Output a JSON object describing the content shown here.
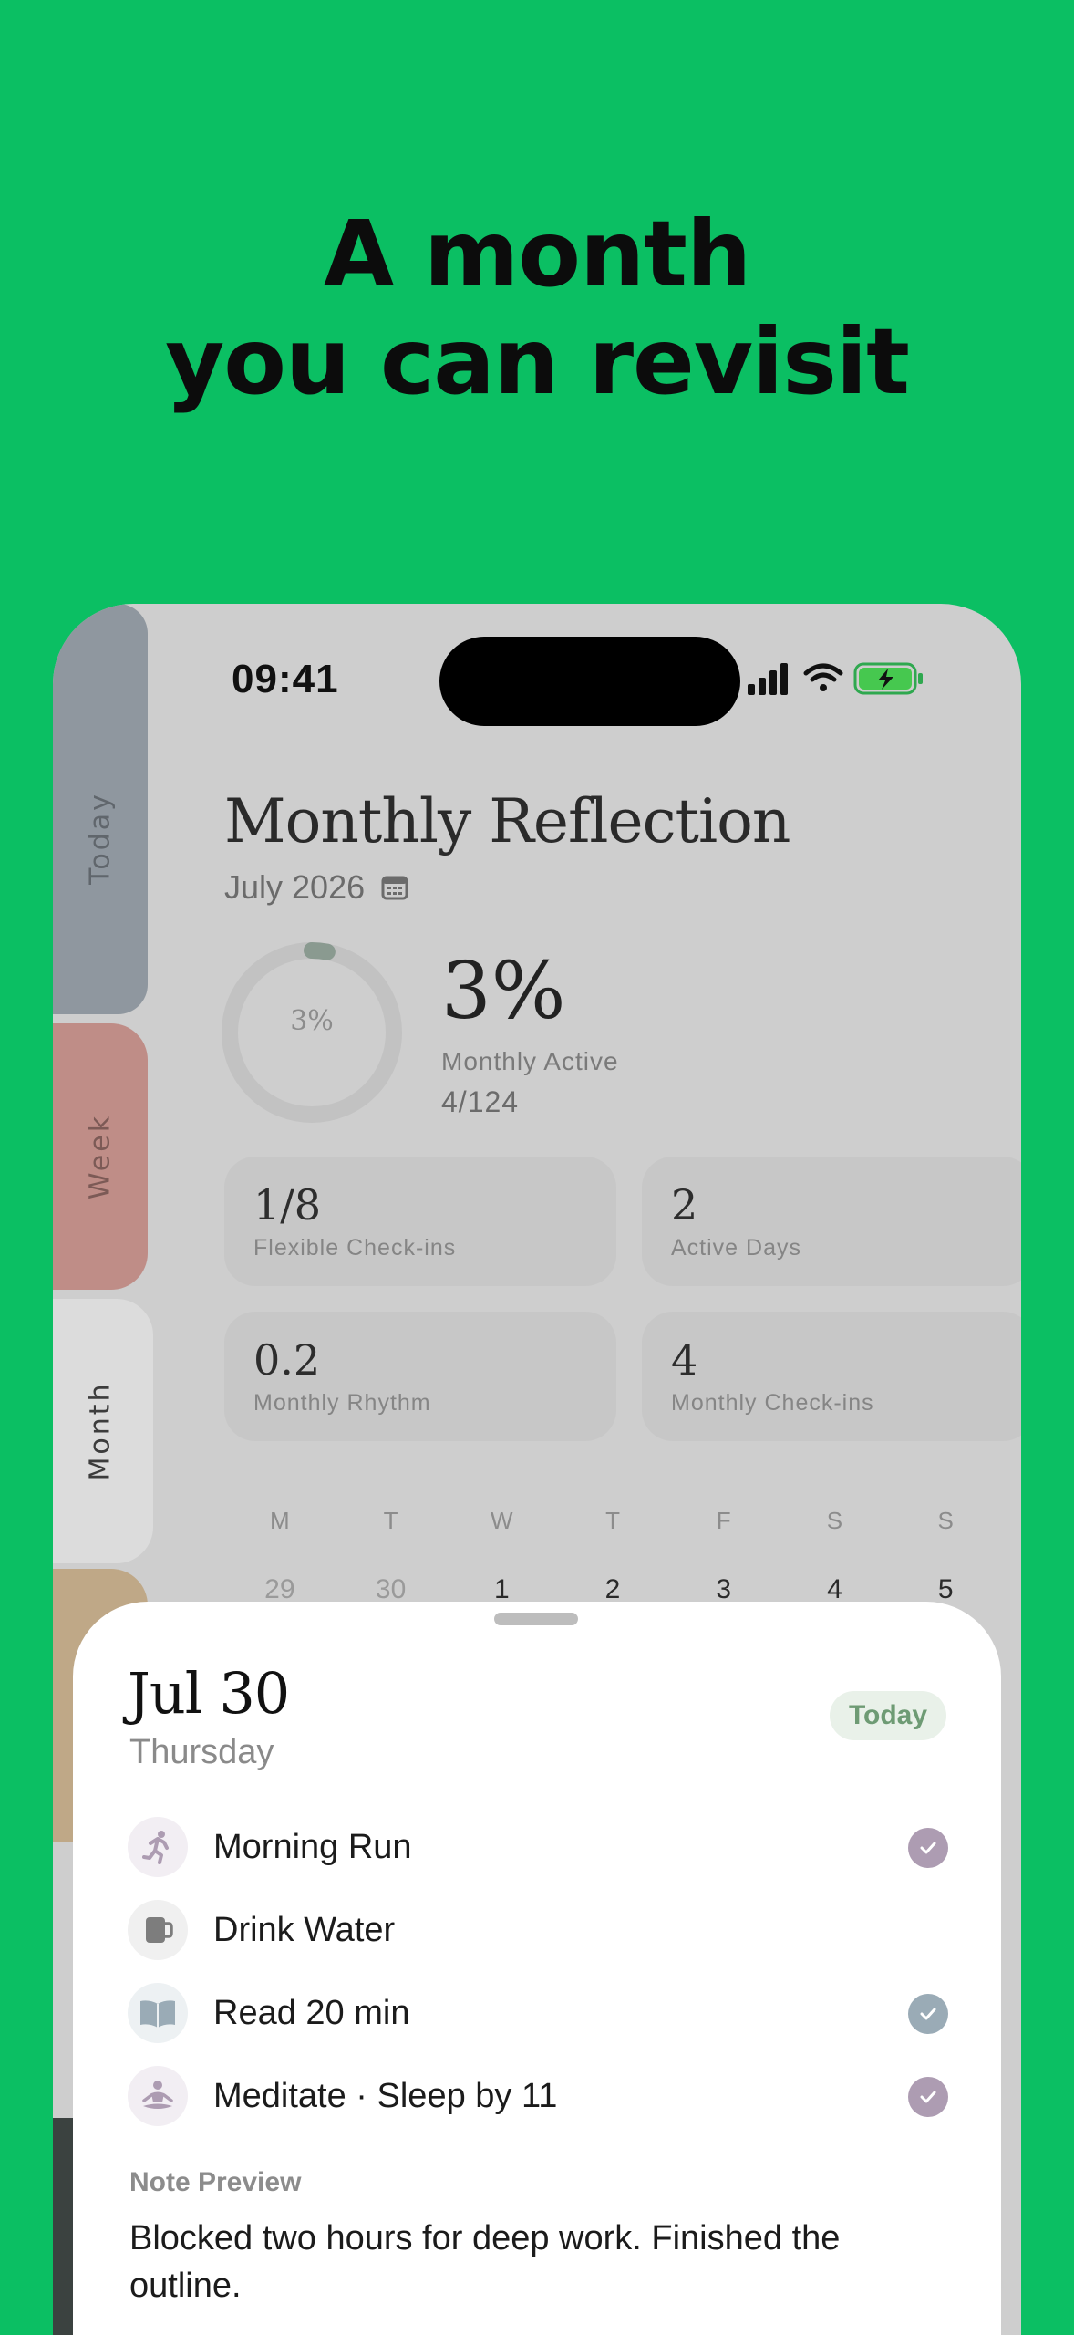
{
  "headline": {
    "line1": "A month",
    "line2": "you can revisit"
  },
  "side_tabs": {
    "today": "Today",
    "week": "Week",
    "month": "Month"
  },
  "status_bar": {
    "time": "09:41"
  },
  "reflection": {
    "title": "Monthly Reflection",
    "month": "July 2026",
    "ring_label": "3%",
    "ring_progress": 0.03,
    "percent": "3%",
    "percent_caption": "Monthly Active",
    "count": "4/124"
  },
  "stats": [
    {
      "value": "1/8",
      "label": "Flexible Check-ins"
    },
    {
      "value": "2",
      "label": "Active Days"
    },
    {
      "value": "0.2",
      "label": "Monthly Rhythm"
    },
    {
      "value": "4",
      "label": "Monthly Check-ins"
    }
  ],
  "calendar": {
    "weekdays": [
      "M",
      "T",
      "W",
      "T",
      "F",
      "S",
      "S"
    ],
    "first_row": [
      "29",
      "30",
      "1",
      "2",
      "3",
      "4",
      "5"
    ]
  },
  "day_sheet": {
    "date": "Jul 30",
    "weekday": "Thursday",
    "badge": "Today",
    "habits": [
      {
        "label": "Morning Run",
        "icon": "running-icon",
        "done": true,
        "color": "#ad9cb2"
      },
      {
        "label": "Drink Water",
        "icon": "mug-icon",
        "done": false,
        "color": "#8a8a8a"
      },
      {
        "label": "Read 20 min",
        "icon": "book-icon",
        "done": true,
        "color": "#9aabb6"
      },
      {
        "label": "Meditate · Sleep by 11",
        "icon": "meditation-icon",
        "done": true,
        "color": "#ad9cb2"
      }
    ],
    "note_title": "Note Preview",
    "note_body": "Blocked two hours for deep work. Finished the outline."
  },
  "colors": {
    "background": "#0bbf63",
    "accent_green": "#6e9b74"
  }
}
